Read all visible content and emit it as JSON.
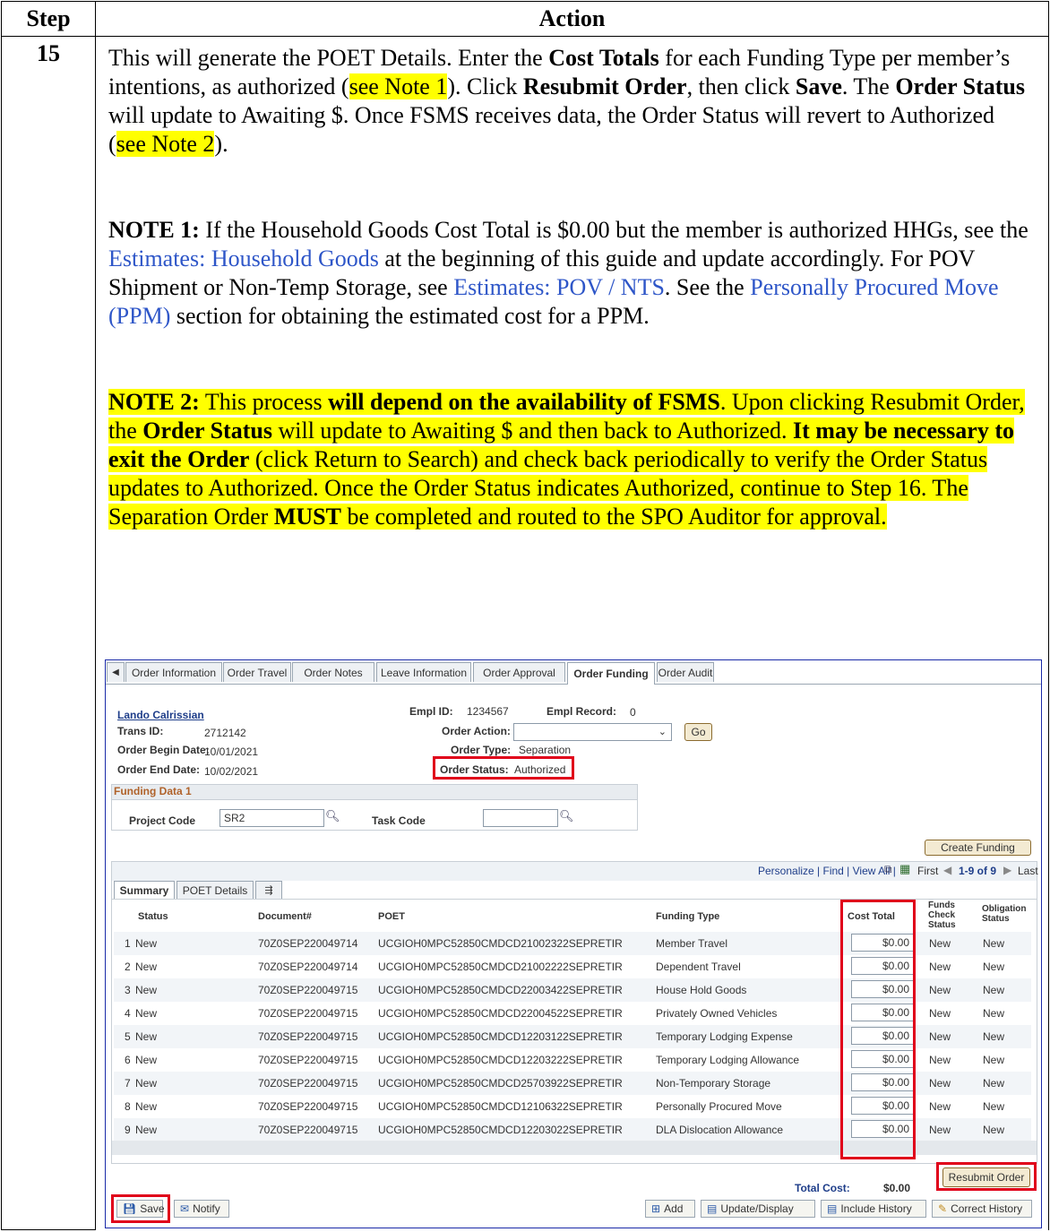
{
  "header": {
    "step_col": "Step",
    "action_col": "Action"
  },
  "step_number": "15",
  "para1": {
    "t1": "This will generate the POET Details.  Enter the ",
    "b1": "Cost Totals",
    "t2": " for each Funding Type per member’s intentions, as authorized (",
    "hl1": "see Note 1",
    "t3": ").  Click ",
    "b2": "Resubmit Order",
    "t4": ", then click ",
    "b3": "Save",
    "t5": ".  The ",
    "b4": "Order Status",
    "t6": " will update to Awaiting $.  Once FSMS receives data, the Order Status will revert to Authorized (",
    "hl2": "see Note 2",
    "t7": ")."
  },
  "note1": {
    "label": "NOTE 1:",
    "t1": "  If the Household Goods Cost Total is $0.00 but the member is authorized HHGs, see the ",
    "link1": "Estimates: Household Goods",
    "t2": " at the beginning of this guide and update accordingly.  For POV Shipment or Non-Temp Storage, see ",
    "link2": "Estimates: POV / NTS",
    "t3": ".  See the ",
    "link3": "Personally Procured Move (PPM)",
    "t4": " section for obtaining the estimated cost for a PPM."
  },
  "note2": {
    "label": "NOTE 2:",
    "t1": "  This process ",
    "b1": "will depend on the availability of FSMS",
    "t2": ".  Upon clicking Resubmit Order, the ",
    "b2": "Order Status",
    "t3": " will update to Awaiting $ and then back to Authorized.  ",
    "b3": "It may be necessary to exit the Order",
    "t4": " (click Return to Search) and check back periodically to verify the Order Status updates to Authorized.  Once the Order Status indicates Authorized, continue to Step 16.  The Separation Order ",
    "b4": "MUST",
    "t5": " be completed and routed to the SPO Auditor for approval."
  },
  "ui": {
    "tabs": [
      "Order Information",
      "Order Travel",
      "Order Notes",
      "Leave Information",
      "Order Approval",
      "Order Funding",
      "Order Audit"
    ],
    "member_name": "Lando Calrissian",
    "empl_id_label": "Empl ID:",
    "empl_id": "1234567",
    "empl_record_label": "Empl Record:",
    "empl_record": "0",
    "trans_id_label": "Trans ID:",
    "trans_id": "2712142",
    "order_action_label": "Order Action:",
    "go_label": "Go",
    "begin_label": "Order Begin Date:",
    "begin_date": "10/01/2021",
    "order_type_label": "Order Type:",
    "order_type": "Separation",
    "end_label": "Order End Date:",
    "end_date": "10/02/2021",
    "order_status_label": "Order Status:",
    "order_status": "Authorized",
    "funding_title": "Funding Data 1",
    "project_code_label": "Project Code",
    "project_code": "SR2",
    "task_code_label": "Task Code",
    "create_funding": "Create Funding",
    "grid_nav": "Personalize | Find | View All |",
    "first": "First",
    "range": "1-9 of 9",
    "last": "Last",
    "subtab_summary": "Summary",
    "subtab_poet": "POET Details",
    "cols": {
      "status": "Status",
      "document": "Document#",
      "poet": "POET",
      "funding_type": "Funding Type",
      "cost_total": "Cost Total",
      "funds_check": "Funds Check Status",
      "obligation": "Obligation Status"
    },
    "rows": [
      {
        "n": "1",
        "status": "New",
        "doc": "70Z0SEP220049714",
        "poet": "UCGIOH0MPC52850CMDCD21002322SEPRETIR",
        "type": "Member Travel",
        "cost": "$0.00",
        "funds": "New",
        "oblig": "New"
      },
      {
        "n": "2",
        "status": "New",
        "doc": "70Z0SEP220049714",
        "poet": "UCGIOH0MPC52850CMDCD21002222SEPRETIR",
        "type": "Dependent Travel",
        "cost": "$0.00",
        "funds": "New",
        "oblig": "New"
      },
      {
        "n": "3",
        "status": "New",
        "doc": "70Z0SEP220049715",
        "poet": "UCGIOH0MPC52850CMDCD22003422SEPRETIR",
        "type": "House Hold Goods",
        "cost": "$0.00",
        "funds": "New",
        "oblig": "New"
      },
      {
        "n": "4",
        "status": "New",
        "doc": "70Z0SEP220049715",
        "poet": "UCGIOH0MPC52850CMDCD22004522SEPRETIR",
        "type": "Privately Owned Vehicles",
        "cost": "$0.00",
        "funds": "New",
        "oblig": "New"
      },
      {
        "n": "5",
        "status": "New",
        "doc": "70Z0SEP220049715",
        "poet": "UCGIOH0MPC52850CMDCD12203122SEPRETIR",
        "type": "Temporary Lodging Expense",
        "cost": "$0.00",
        "funds": "New",
        "oblig": "New"
      },
      {
        "n": "6",
        "status": "New",
        "doc": "70Z0SEP220049715",
        "poet": "UCGIOH0MPC52850CMDCD12203222SEPRETIR",
        "type": "Temporary Lodging Allowance",
        "cost": "$0.00",
        "funds": "New",
        "oblig": "New"
      },
      {
        "n": "7",
        "status": "New",
        "doc": "70Z0SEP220049715",
        "poet": "UCGIOH0MPC52850CMDCD25703922SEPRETIR",
        "type": "Non-Temporary Storage",
        "cost": "$0.00",
        "funds": "New",
        "oblig": "New"
      },
      {
        "n": "8",
        "status": "New",
        "doc": "70Z0SEP220049715",
        "poet": "UCGIOH0MPC52850CMDCD12106322SEPRETIR",
        "type": "Personally Procured Move",
        "cost": "$0.00",
        "funds": "New",
        "oblig": "New"
      },
      {
        "n": "9",
        "status": "New",
        "doc": "70Z0SEP220049715",
        "poet": "UCGIOH0MPC52850CMDCD12203022SEPRETIR",
        "type": "DLA Dislocation Allowance",
        "cost": "$0.00",
        "funds": "New",
        "oblig": "New"
      }
    ],
    "total_cost_label": "Total Cost:",
    "total_cost": "$0.00",
    "resubmit": "Resubmit Order",
    "save": "Save",
    "notify": "Notify",
    "add": "Add",
    "update_display": "Update/Display",
    "include_history": "Include History",
    "correct_history": "Correct History"
  },
  "colors": {
    "highlight": "#ffff00",
    "link": "#2e56c8",
    "red_box": "#e0001a"
  }
}
